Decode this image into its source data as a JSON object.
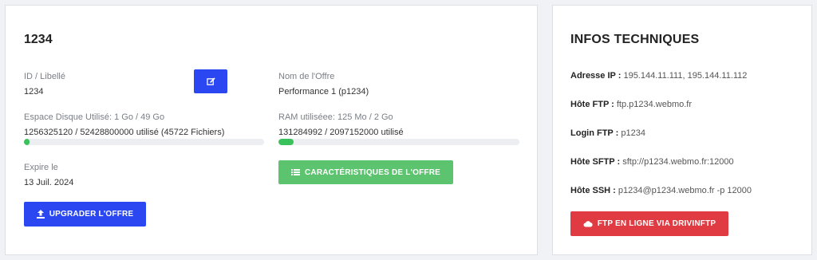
{
  "main": {
    "title": "1234",
    "id_label": "ID / Libellé",
    "id_value": "1234",
    "offer_name_label": "Nom de l'Offre",
    "offer_name_value": "Performance 1 (p1234)",
    "disk_label": "Espace Disque Utilisé: 1 Go / 49 Go",
    "disk_value": "1256325120 / 52428800000 utilisé (45722 Fichiers)",
    "disk_progress_fraction": 0.024,
    "ram_label": "RAM utiliséee: 125 Mo / 2 Go",
    "ram_value": "131284992 / 2097152000 utilisé",
    "ram_progress_fraction": 0.063,
    "expire_label": "Expire le",
    "expire_value": "13 Juil. 2024",
    "offer_features_button": "CARACTÉRISTIQUES DE L'OFFRE",
    "upgrade_button": "UPGRADER L'OFFRE",
    "edit_icon": "edit-icon"
  },
  "info": {
    "title": "INFOS TECHNIQUES",
    "rows": [
      {
        "label": "Adresse IP :",
        "value": "195.144.11.111, 195.144.11.112"
      },
      {
        "label": "Hôte FTP :",
        "value": "ftp.p1234.webmo.fr"
      },
      {
        "label": "Login FTP :",
        "value": "p1234"
      },
      {
        "label": "Hôte SFTP :",
        "value": "sftp://p1234.webmo.fr:12000"
      },
      {
        "label": "Hôte SSH :",
        "value": "p1234@p1234.webmo.fr -p 12000"
      }
    ],
    "ftp_button": "FTP EN LIGNE VIA DRIVINFTP"
  },
  "colors": {
    "primary": "#2b47f2",
    "success": "#5cc36e",
    "danger": "#e03b42",
    "progress": "#39c25b"
  }
}
